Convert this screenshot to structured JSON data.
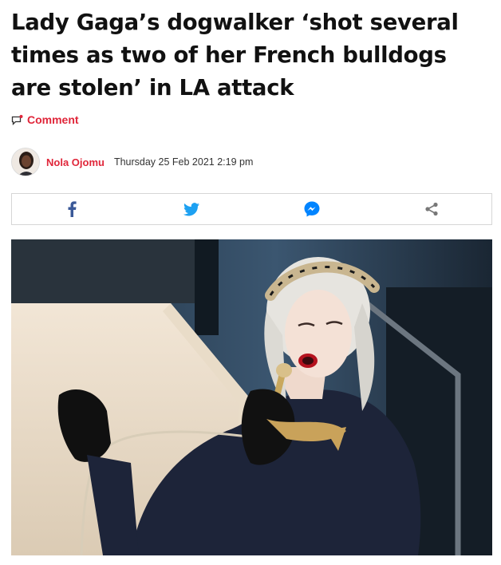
{
  "article": {
    "headline": "Lady Gaga’s dogwalker ‘shot several times as two of her French bulldogs are stolen’ in LA attack",
    "comment_label": "Comment",
    "author": "Nola Ojomu",
    "date": "Thursday 25 Feb 2021 2:19 pm"
  },
  "share": {
    "items": [
      "facebook-icon",
      "twitter-icon",
      "messenger-icon",
      "share-icon"
    ],
    "colors": {
      "facebook": "#3b5998",
      "twitter": "#1da1f2",
      "messenger": "#0084ff",
      "share": "#777777"
    }
  },
  "colors": {
    "accent": "#e0263a"
  },
  "hero_image": {
    "alt": "Lady Gaga singing into a gold microphone"
  }
}
